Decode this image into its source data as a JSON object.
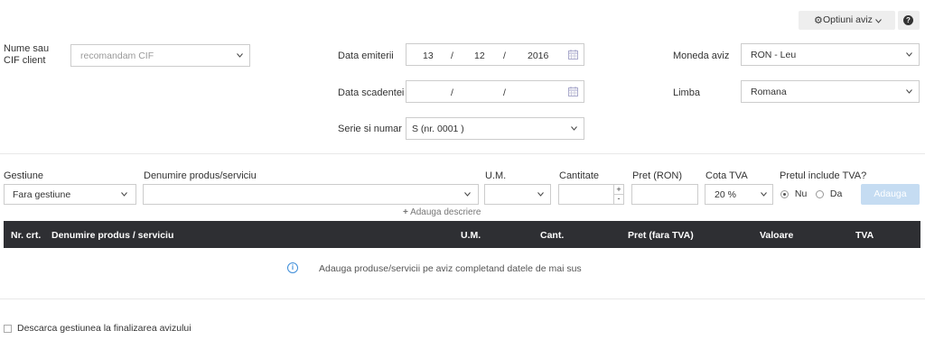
{
  "toolbar": {
    "options_label": "Optiuni aviz",
    "help_icon": "question-circle-icon"
  },
  "client": {
    "label": "Nume sau CIF client",
    "placeholder": "recomandam CIF"
  },
  "dates": {
    "emit_label": "Data emiterii",
    "emit_day": "13",
    "emit_month": "12",
    "emit_year": "2016",
    "due_label": "Data scadentei",
    "separator": "/"
  },
  "series": {
    "label": "Serie si numar",
    "value": "S (nr. 0001 )"
  },
  "currency": {
    "label": "Moneda aviz",
    "value": "RON - Leu"
  },
  "language": {
    "label": "Limba",
    "value": "Romana"
  },
  "product_form": {
    "gestiune_label": "Gestiune",
    "gestiune_value": "Fara gestiune",
    "product_label": "Denumire produs/serviciu",
    "um_label": "U.M.",
    "qty_label": "Cantitate",
    "price_label": "Pret (RON)",
    "vat_label": "Cota TVA",
    "vat_value": "20 %",
    "includes_vat_label": "Pretul include TVA?",
    "opt_no": "Nu",
    "opt_yes": "Da",
    "add_button": "Adauga",
    "add_description": "Adauga descriere",
    "plus": "+",
    "minus": "-"
  },
  "table": {
    "columns": [
      "Nr. crt.",
      "Denumire produs / serviciu",
      "U.M.",
      "Cant.",
      "Pret (fara TVA)",
      "Valoare",
      "TVA"
    ],
    "empty_message": "Adauga produse/servicii pe aviz completand datele de mai sus"
  },
  "footer": {
    "checkbox_label": "Descarca gestiunea la finalizarea avizului"
  },
  "colors": {
    "header_bg": "#2e2f33",
    "add_button_bg": "#c5dcf2",
    "info_icon": "#3c8dd9"
  }
}
